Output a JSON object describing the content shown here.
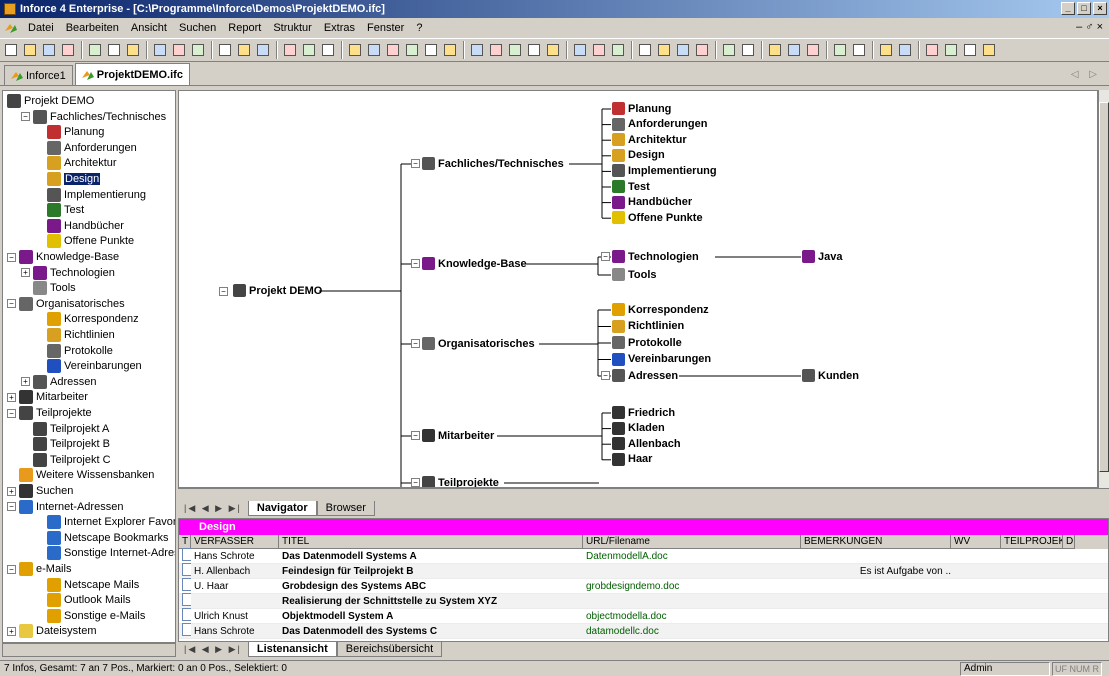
{
  "window": {
    "title": "Inforce 4 Enterprise - [C:\\Programme\\Inforce\\Demos\\ProjektDEMO.ifc]"
  },
  "menu": [
    "Datei",
    "Bearbeiten",
    "Ansicht",
    "Suchen",
    "Report",
    "Struktur",
    "Extras",
    "Fenster",
    "?"
  ],
  "menu_right": "– ♂ ×",
  "doc_tabs": [
    "Inforce1",
    "ProjektDEMO.ifc"
  ],
  "tree": [
    {
      "label": "Projekt DEMO",
      "icon": "project-icon"
    },
    {
      "label": "Fachliches/Technisches",
      "icon": "tech-icon"
    },
    {
      "label": "Planung",
      "icon": "clock-icon"
    },
    {
      "label": "Anforderungen",
      "icon": "pointer-icon"
    },
    {
      "label": "Architektur",
      "icon": "architecture-icon"
    },
    {
      "label": "Design",
      "icon": "design-icon"
    },
    {
      "label": "Implementierung",
      "icon": "implementation-icon"
    },
    {
      "label": "Test",
      "icon": "test-icon"
    },
    {
      "label": "Handbücher",
      "icon": "books-icon"
    },
    {
      "label": "Offene Punkte",
      "icon": "pencil-icon"
    },
    {
      "label": "Knowledge-Base",
      "icon": "books-icon"
    },
    {
      "label": "Technologien",
      "icon": "books-icon"
    },
    {
      "label": "Tools",
      "icon": "tool-icon"
    },
    {
      "label": "Organisatorisches",
      "icon": "chart-icon"
    },
    {
      "label": "Korrespondenz",
      "icon": "mail-icon"
    },
    {
      "label": "Richtlinien",
      "icon": "architecture-icon"
    },
    {
      "label": "Protokolle",
      "icon": "quill-icon"
    },
    {
      "label": "Vereinbarungen",
      "icon": "handshake-icon"
    },
    {
      "label": "Adressen",
      "icon": "phone-icon"
    },
    {
      "label": "Mitarbeiter",
      "icon": "person-icon"
    },
    {
      "label": "Teilprojekte",
      "icon": "project-icon"
    },
    {
      "label": "Teilprojekt A",
      "icon": "project-icon"
    },
    {
      "label": "Teilprojekt B",
      "icon": "project-icon"
    },
    {
      "label": "Teilprojekt C",
      "icon": "project-icon"
    },
    {
      "label": "Weitere Wissensbanken",
      "icon": "inforce-icon"
    },
    {
      "label": "Suchen",
      "icon": "search-icon"
    },
    {
      "label": "Internet-Adressen",
      "icon": "globe-icon"
    },
    {
      "label": "Internet Explorer Favoriten",
      "icon": "globe-icon"
    },
    {
      "label": "Netscape Bookmarks",
      "icon": "globe-icon"
    },
    {
      "label": "Sonstige Internet-Adressen",
      "icon": "globe-icon"
    },
    {
      "label": "e-Mails",
      "icon": "mail-icon"
    },
    {
      "label": "Netscape Mails",
      "icon": "mail-icon"
    },
    {
      "label": "Outlook Mails",
      "icon": "mail-icon"
    },
    {
      "label": "Sonstige e-Mails",
      "icon": "mail-icon"
    },
    {
      "label": "Dateisystem",
      "icon": "folder-icon"
    }
  ],
  "diagram": {
    "root": "Projekt DEMO",
    "branches": [
      "Fachliches/Technisches",
      "Knowledge-Base",
      "Organisatorisches",
      "Mitarbeiter",
      "Teilprojekte"
    ],
    "fachliches": [
      "Planung",
      "Anforderungen",
      "Architektur",
      "Design",
      "Implementierung",
      "Test",
      "Handbücher",
      "Offene Punkte"
    ],
    "knowledge": [
      "Technologien",
      "Tools"
    ],
    "knowledge_sub": "Java",
    "organisatorisches": [
      "Korrespondenz",
      "Richtlinien",
      "Protokolle",
      "Vereinbarungen",
      "Adressen"
    ],
    "adressen_sub": "Kunden",
    "mitarbeiter": [
      "Friedrich",
      "Kladen",
      "Allenbach",
      "Haar"
    ]
  },
  "sheet_tabs": [
    "Navigator",
    "Browser"
  ],
  "list": {
    "title": "Design",
    "columns": [
      "T",
      "VERFASSER",
      "TITEL",
      "URL/Filename",
      "BEMERKUNGEN",
      "WV",
      "TEILPROJEKT",
      "D"
    ],
    "rows": [
      {
        "author": "Hans Schrote",
        "title": "Das Datenmodell Systems A",
        "url": "DatenmodellA.doc",
        "note": ""
      },
      {
        "author": "H. Allenbach",
        "title": "Feindesign für Teilprojekt B",
        "url": "",
        "note": "Es ist Aufgabe von .."
      },
      {
        "author": "U. Haar",
        "title": "Grobdesign des Systems ABC",
        "url": "grobdesigndemo.doc",
        "note": ""
      },
      {
        "author": "",
        "title": "Realisierung der Schnittstelle zu System XYZ",
        "url": "",
        "note": ""
      },
      {
        "author": "Ulrich Knust",
        "title": "Objektmodell System A",
        "url": "objectmodella.doc",
        "note": ""
      },
      {
        "author": "Hans Schrote",
        "title": "Das Datenmodell des Systems C",
        "url": "datamodellc.doc",
        "note": ""
      }
    ]
  },
  "list_tabs": [
    "Listenansicht",
    "Bereichsübersicht"
  ],
  "status": {
    "text": "7 Infos,  Gesamt: 7 an 7 Pos.,  Markiert: 0 an 0 Pos., Selektiert: 0",
    "user": "Admin",
    "indicators": "UF NUM R"
  },
  "colors": {
    "title_start": "#0a246a",
    "list_header": "#ff00ff",
    "selection": "#0a246a",
    "url_text": "#006000"
  }
}
